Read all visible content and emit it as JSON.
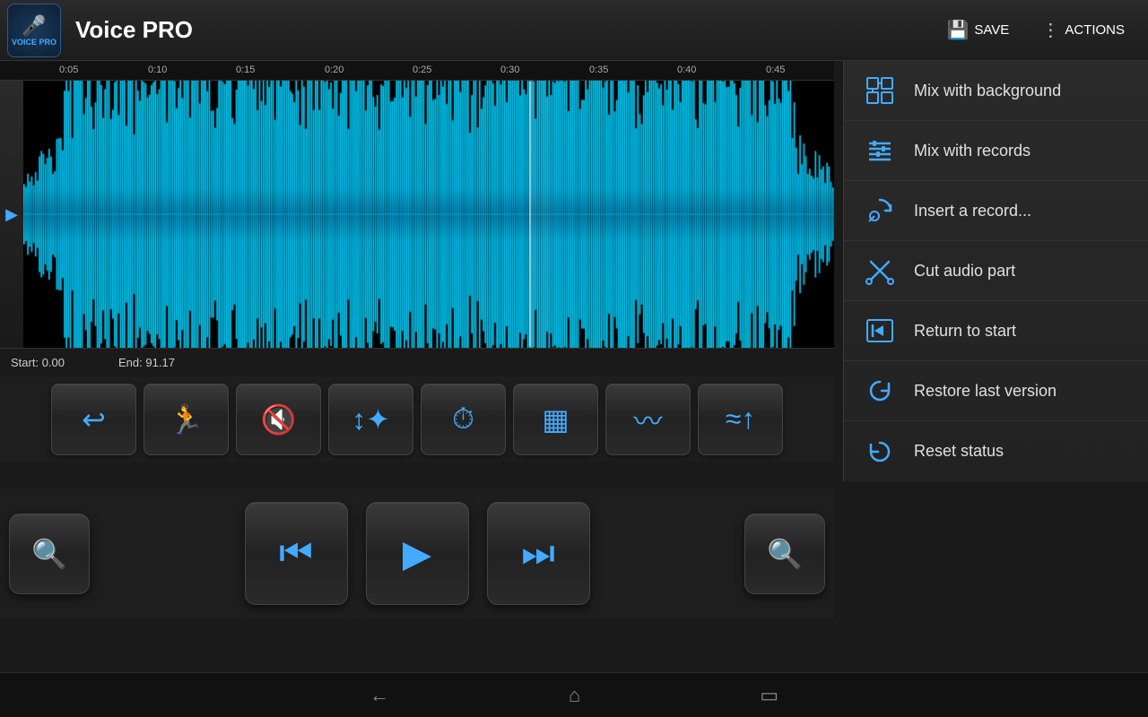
{
  "app": {
    "title": "Voice PRO",
    "logo_text": "VOICE PRO"
  },
  "header": {
    "save_label": "SAVE",
    "actions_label": "ACTIONS"
  },
  "timeline": {
    "markers": [
      "0:05",
      "0:10",
      "0:15",
      "0:20",
      "0:25",
      "0:30",
      "0:35",
      "0:40",
      "0:45"
    ]
  },
  "status": {
    "start_label": "Start:",
    "start_value": "0.00",
    "end_label": "End:",
    "end_value": "91.17"
  },
  "menu": {
    "items": [
      {
        "id": "mix-bg",
        "label": "Mix with background",
        "icon": "⊞"
      },
      {
        "id": "mix-rec",
        "label": "Mix with records",
        "icon": "⊟"
      },
      {
        "id": "insert-rec",
        "label": "Insert a record...",
        "icon": "↻"
      },
      {
        "id": "cut-audio",
        "label": "Cut audio part",
        "icon": "✂"
      },
      {
        "id": "return-start",
        "label": "Return to start",
        "icon": "⊞"
      },
      {
        "id": "restore",
        "label": "Restore last version",
        "icon": "↩"
      },
      {
        "id": "reset",
        "label": "Reset status",
        "icon": "↺"
      }
    ]
  },
  "effects": {
    "buttons": [
      {
        "id": "undo",
        "icon": "↩"
      },
      {
        "id": "noise-reduce",
        "icon": "🏃"
      },
      {
        "id": "mute",
        "icon": "🚫"
      },
      {
        "id": "pitch",
        "icon": "↕"
      },
      {
        "id": "time",
        "icon": "⏱"
      },
      {
        "id": "equalizer",
        "icon": "▦"
      },
      {
        "id": "waveform",
        "icon": "〰"
      },
      {
        "id": "effects",
        "icon": "〰"
      }
    ]
  },
  "transport": {
    "buttons": [
      {
        "id": "zoom-out",
        "icon": "🔍-"
      },
      {
        "id": "prev",
        "icon": "⏮"
      },
      {
        "id": "play",
        "icon": "▶"
      },
      {
        "id": "next",
        "icon": "⏭"
      },
      {
        "id": "zoom-in",
        "icon": "🔍+"
      }
    ]
  },
  "nav": {
    "back_icon": "←",
    "home_icon": "⌂",
    "recents_icon": "▭"
  }
}
